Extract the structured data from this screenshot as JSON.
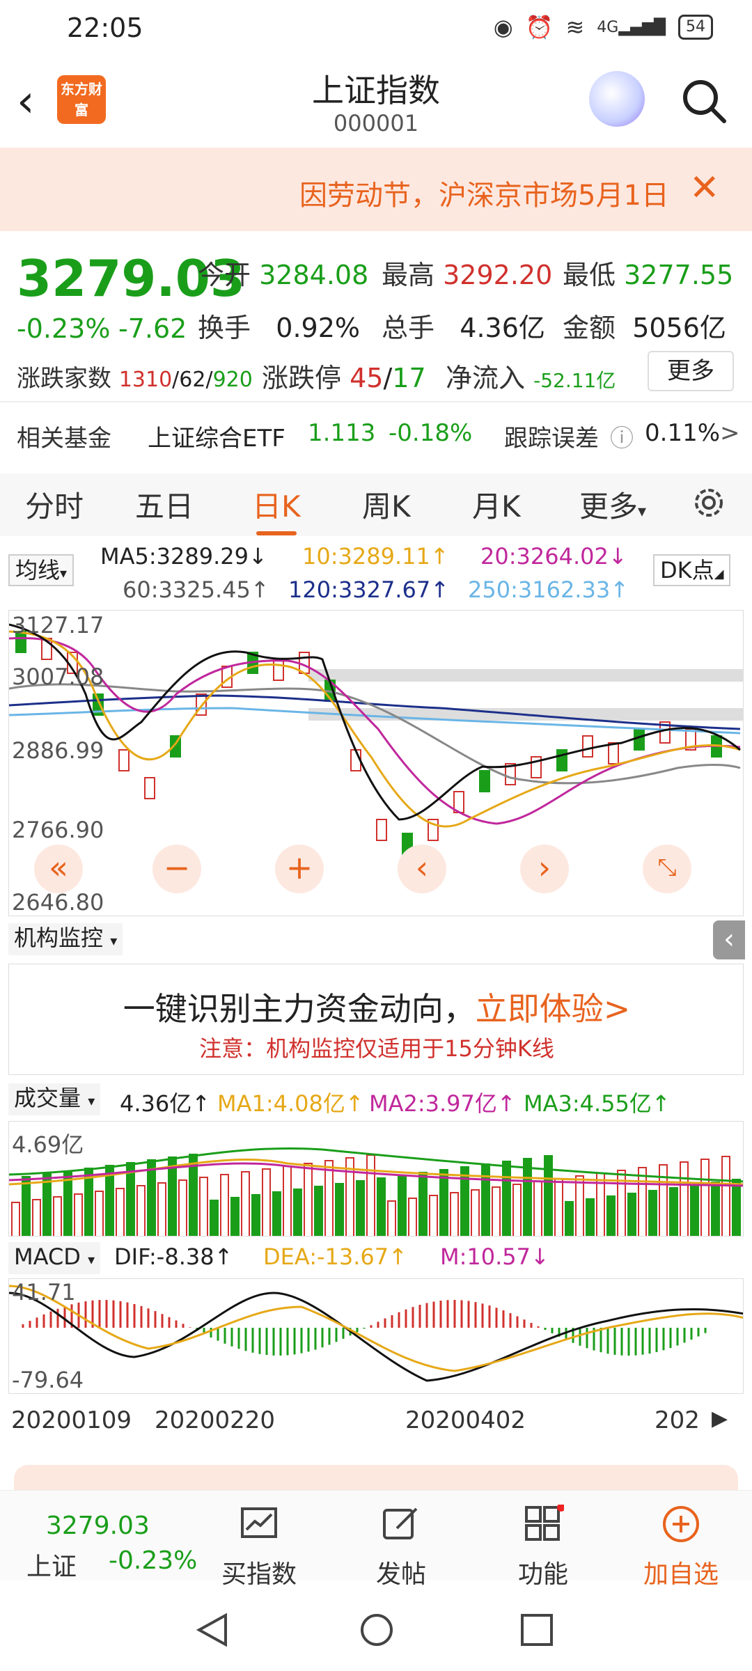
{
  "status": {
    "time": "22:05",
    "network": "4G",
    "battery": "54"
  },
  "header": {
    "title": "上证指数",
    "code": "000001",
    "logo_text": "东方财富"
  },
  "notice": {
    "text": "因劳动节，沪深京市场5月1日"
  },
  "quote": {
    "price": "3279.03",
    "change_pct": "-0.23%",
    "change": "-7.62",
    "open_label": "今开",
    "open": "3284.08",
    "high_label": "最高",
    "high": "3292.20",
    "low_label": "最低",
    "low": "3277.55",
    "turnover_label": "换手",
    "turnover": "0.92%",
    "volume_label": "总手",
    "volume": "4.36亿",
    "amount_label": "金额",
    "amount": "5056亿",
    "breadth_label": "涨跌家数",
    "breadth_up": "1310",
    "breadth_flat": "62",
    "breadth_down": "920",
    "limit_label": "涨跌停",
    "limit_up": "45",
    "limit_down": "17",
    "inflow_label": "净流入",
    "inflow": "-52.11亿",
    "more": "更多"
  },
  "fund": {
    "label": "相关基金",
    "name": "上证综合ETF",
    "price": "1.113",
    "change": "-0.18%",
    "tracking_label": "跟踪误差",
    "tracking": "0.11%"
  },
  "tabs": [
    "分时",
    "五日",
    "日K",
    "周K",
    "月K",
    "更多"
  ],
  "ma": {
    "selector": "均线",
    "ma5": "MA5:3289.29↓",
    "ma10": "10:3289.11↑",
    "ma20": "20:3264.02↓",
    "ma60": "60:3325.45↑",
    "ma120": "120:3327.67↑",
    "ma250": "250:3162.33↑",
    "dk": "DK点"
  },
  "kchart": {
    "y_labels": [
      "3127.17",
      "3007.08",
      "2886.99",
      "2766.90",
      "2646.80"
    ]
  },
  "monitor": {
    "selector": "机构监控",
    "headline": "一键识别主力资金动向，",
    "cta": "立即体验>",
    "note": "注意：机构监控仅适用于15分钟K线"
  },
  "volume": {
    "selector": "成交量",
    "value": "4.36亿↑",
    "ma1": "MA1:4.08亿↑",
    "ma2": "MA2:3.97亿↑",
    "ma3": "MA3:4.55亿↑",
    "y_label": "4.69亿"
  },
  "macd": {
    "selector": "MACD",
    "dif": "DIF:-8.38↑",
    "dea": "DEA:-13.67↑",
    "m": "M:10.57↓",
    "y_top": "41.71",
    "y_bottom": "-79.64"
  },
  "dates": [
    "20200109",
    "20200220",
    "20200402",
    "202"
  ],
  "bottom": {
    "index_price": "3279.03",
    "index_name": "上证",
    "index_change": "-0.23%",
    "buy": "买指数",
    "post": "发帖",
    "func": "功能",
    "add": "加自选"
  },
  "colors": {
    "up": "#d0312d",
    "down": "#1a9e1a",
    "accent": "#e8631e"
  }
}
